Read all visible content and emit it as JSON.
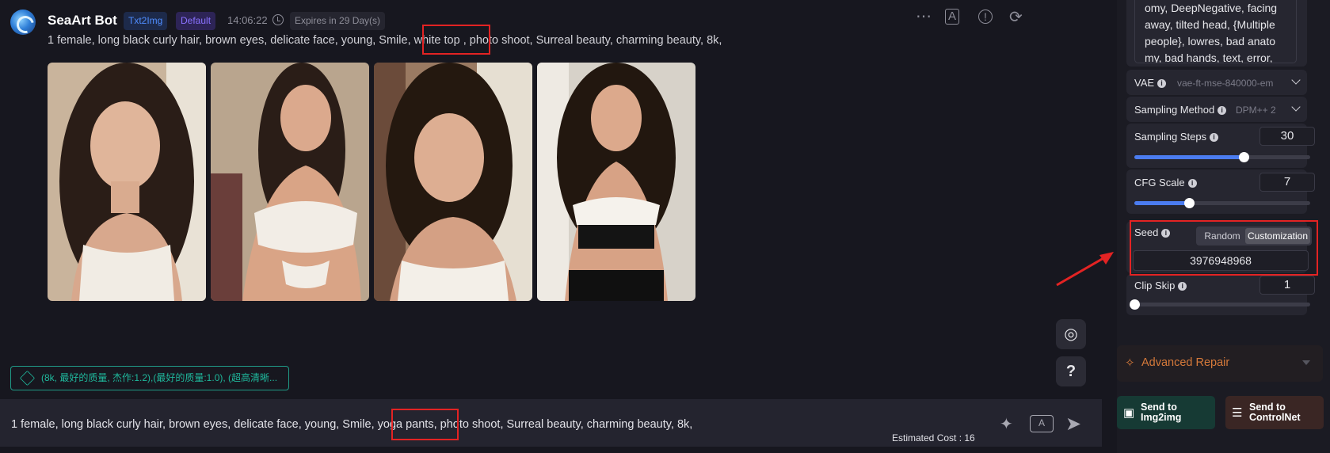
{
  "header": {
    "bot_name": "SeaArt Bot",
    "badge_mode": "Txt2Img",
    "badge_model": "Default",
    "time": "14:06:22",
    "expires": "Expires in 29 Day(s)"
  },
  "message": {
    "prompt_before": "1 female, long black curly hair, brown eyes, delicate face, young, Smile,",
    "prompt_highlight": "white top ,",
    "prompt_after": "photo shoot, Surreal beauty, charming beauty, 8k,"
  },
  "images": [
    {
      "name": "generated-image-1"
    },
    {
      "name": "generated-image-2"
    },
    {
      "name": "generated-image-3"
    },
    {
      "name": "generated-image-4"
    }
  ],
  "tag_chip": "(8k, 最好的质量, 杰作:1.2),(最好的质量:1.0), (超高清晰...",
  "input": {
    "text_before": "1 female,  long black curly hair, brown eyes, delicate face, young, Smile,",
    "text_highlight": "yoga pants,",
    "text_after": "photo shoot, Surreal beauty, charming beauty, 8k,",
    "estimated_cost": "Estimated Cost : 16"
  },
  "panel": {
    "negative_prompt_lines": [
      "omy, DeepNegative, facing",
      "away, tilted head, {Multiple",
      "people}, lowres, bad anato",
      "my, bad hands, text, error,"
    ],
    "vae": {
      "label": "VAE",
      "value": "vae-ft-mse-840000-em"
    },
    "sampling_method": {
      "label": "Sampling Method",
      "value": "DPM++ 2"
    },
    "sampling_steps": {
      "label": "Sampling Steps",
      "value": "30",
      "fraction": 0.62
    },
    "cfg_scale": {
      "label": "CFG Scale",
      "value": "7",
      "fraction": 0.31
    },
    "seed": {
      "label": "Seed",
      "random_label": "Random",
      "custom_label": "Customization",
      "value": "3976948968"
    },
    "clip_skip": {
      "label": "Clip Skip",
      "value": "1",
      "fraction": 0.0
    },
    "advanced_repair": "Advanced Repair",
    "send_img2img": "Send to Img2img",
    "send_controlnet": "Send to ControlNet"
  },
  "colors": {
    "accent": "#4b7cf0",
    "highlight_box": "#e32323",
    "repair": "#d5793a"
  }
}
